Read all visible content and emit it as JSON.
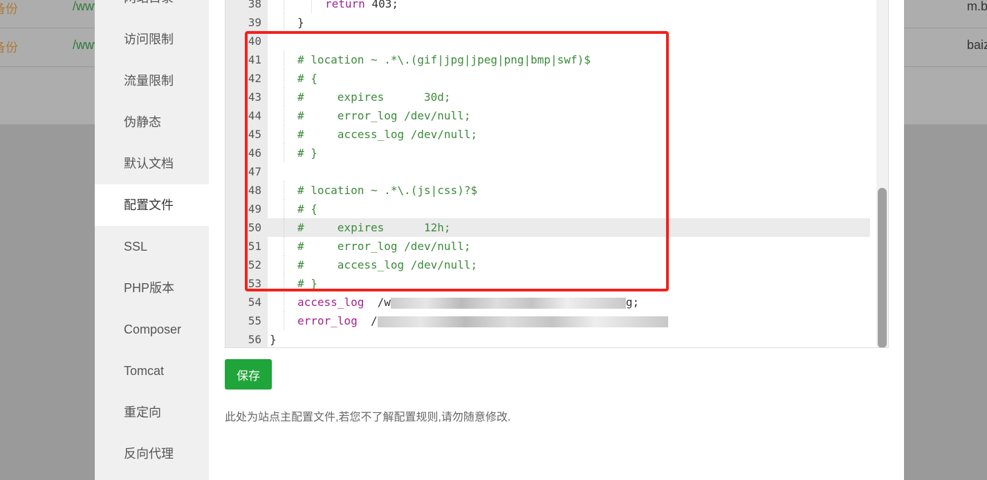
{
  "background_rows": [
    {
      "name": "备份",
      "path": "/www",
      "domain": "m.b"
    },
    {
      "name": "备份",
      "path": "/www",
      "domain": "baiz"
    }
  ],
  "sidebar": {
    "items": [
      {
        "label": "网站目录"
      },
      {
        "label": "访问限制"
      },
      {
        "label": "流量限制"
      },
      {
        "label": "伪静态"
      },
      {
        "label": "默认文档"
      },
      {
        "label": "配置文件",
        "active": true
      },
      {
        "label": "SSL"
      },
      {
        "label": "PHP版本"
      },
      {
        "label": "Composer"
      },
      {
        "label": "Tomcat"
      },
      {
        "label": "重定向"
      },
      {
        "label": "反向代理"
      }
    ]
  },
  "editor": {
    "highlighted_line": 50,
    "lines": [
      {
        "n": "38",
        "indent": 2,
        "text": "return 403;",
        "type": "ret"
      },
      {
        "n": "39",
        "indent": 1,
        "text": "}",
        "type": "plain"
      },
      {
        "n": "40",
        "indent": 0,
        "text": "",
        "type": "plain"
      },
      {
        "n": "41",
        "indent": 1,
        "text": "# location ~ .*\\.(gif|jpg|jpeg|png|bmp|swf)$",
        "type": "comment"
      },
      {
        "n": "42",
        "indent": 1,
        "text": "# {",
        "type": "comment"
      },
      {
        "n": "43",
        "indent": 1,
        "text": "#     expires      30d;",
        "type": "comment"
      },
      {
        "n": "44",
        "indent": 1,
        "text": "#     error_log /dev/null;",
        "type": "comment"
      },
      {
        "n": "45",
        "indent": 1,
        "text": "#     access_log /dev/null;",
        "type": "comment"
      },
      {
        "n": "46",
        "indent": 1,
        "text": "# }",
        "type": "comment"
      },
      {
        "n": "47",
        "indent": 0,
        "text": "",
        "type": "plain"
      },
      {
        "n": "48",
        "indent": 1,
        "text": "# location ~ .*\\.(js|css)?$",
        "type": "comment"
      },
      {
        "n": "49",
        "indent": 1,
        "text": "# {",
        "type": "comment"
      },
      {
        "n": "50",
        "indent": 1,
        "text": "#     expires      12h;",
        "type": "comment"
      },
      {
        "n": "51",
        "indent": 1,
        "text": "#     error_log /dev/null;",
        "type": "comment"
      },
      {
        "n": "52",
        "indent": 1,
        "text": "#     access_log /dev/null;",
        "type": "comment"
      },
      {
        "n": "53",
        "indent": 1,
        "text": "# }",
        "type": "comment"
      },
      {
        "n": "54",
        "indent": 1,
        "text": "access_log",
        "rest": "  /w",
        "tail": "g;",
        "type": "blur"
      },
      {
        "n": "55",
        "indent": 1,
        "text": "error_log",
        "rest": "  /",
        "tail": "",
        "type": "blur"
      },
      {
        "n": "56",
        "indent": 0,
        "text": "}",
        "type": "plain"
      }
    ]
  },
  "save_label": "保存",
  "hint": "此处为站点主配置文件,若您不了解配置规则,请勿随意修改.",
  "colors": {
    "save": "#20a53a",
    "highlight_box": "#f5201a",
    "comment": "#3b8a3b",
    "keyword": "#a0228f"
  }
}
